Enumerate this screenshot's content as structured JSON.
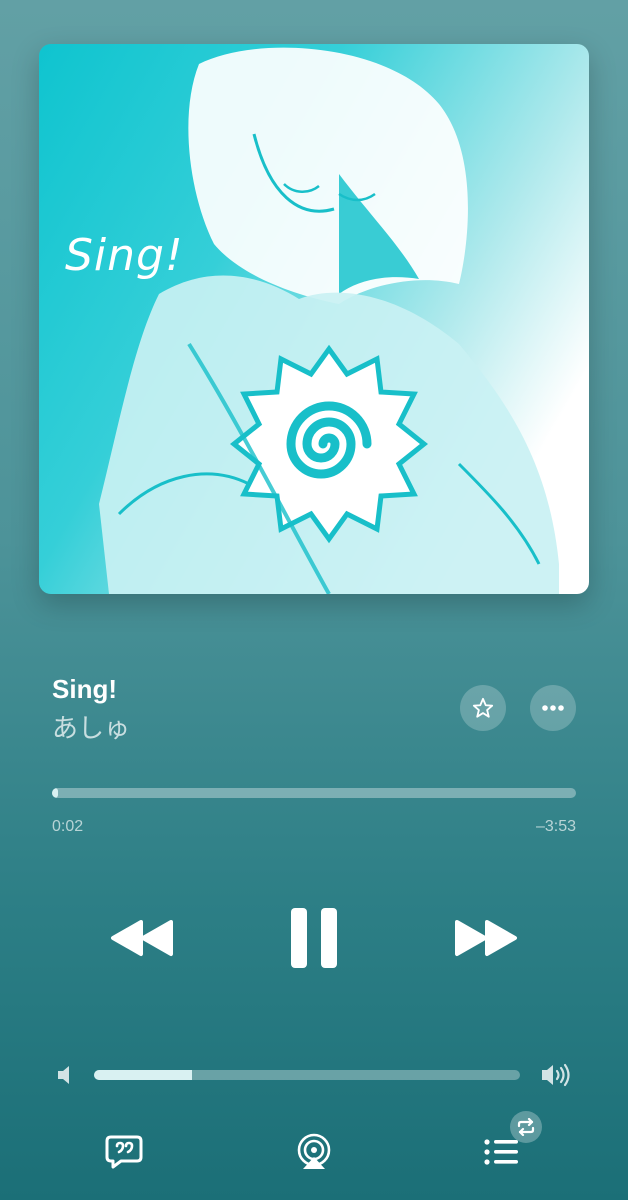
{
  "album": {
    "art_text": "Sing!",
    "icon": "album-artwork"
  },
  "track": {
    "title": "Sing!",
    "artist": "あしゅ"
  },
  "progress": {
    "elapsed": "0:02",
    "remaining": "–3:53",
    "fraction": 0.009
  },
  "volume": {
    "fraction": 0.23
  },
  "icons": {
    "favorite": "star-icon",
    "more": "ellipsis-icon",
    "rewind": "rewind-icon",
    "pause": "pause-icon",
    "forward": "fast-forward-icon",
    "volume_low": "speaker-low-icon",
    "volume_high": "speaker-high-icon",
    "lyrics": "lyrics-icon",
    "airplay": "airplay-icon",
    "queue": "queue-list-icon",
    "repeat": "repeat-icon"
  },
  "colors": {
    "background_top": "#62a0a5",
    "background_bottom": "#1b6f77",
    "art_cyan": "#0fc4cf",
    "accent_light": "#d9f1f2"
  }
}
